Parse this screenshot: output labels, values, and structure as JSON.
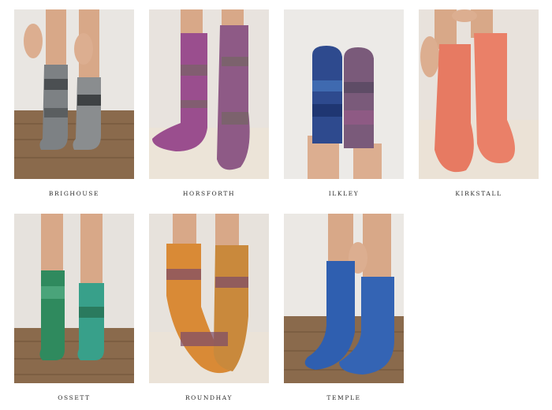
{
  "gallery": {
    "items": [
      {
        "label": "BRIGHOUSE",
        "icon": "gray-socks-image"
      },
      {
        "label": "HORSFORTH",
        "icon": "purple-socks-image"
      },
      {
        "label": "ILKLEY",
        "icon": "blue-purple-socks-image"
      },
      {
        "label": "KIRKSTALL",
        "icon": "coral-socks-image"
      },
      {
        "label": "OSSETT",
        "icon": "green-socks-image"
      },
      {
        "label": "ROUNDHAY",
        "icon": "orange-purple-socks-image"
      },
      {
        "label": "TEMPLE",
        "icon": "blue-socks-image"
      }
    ]
  },
  "colors": {
    "background": "#ffffff",
    "caption_text": "#2a2a2a",
    "wood_floor": "#8a6a4c",
    "wall": "#eeeae6"
  }
}
